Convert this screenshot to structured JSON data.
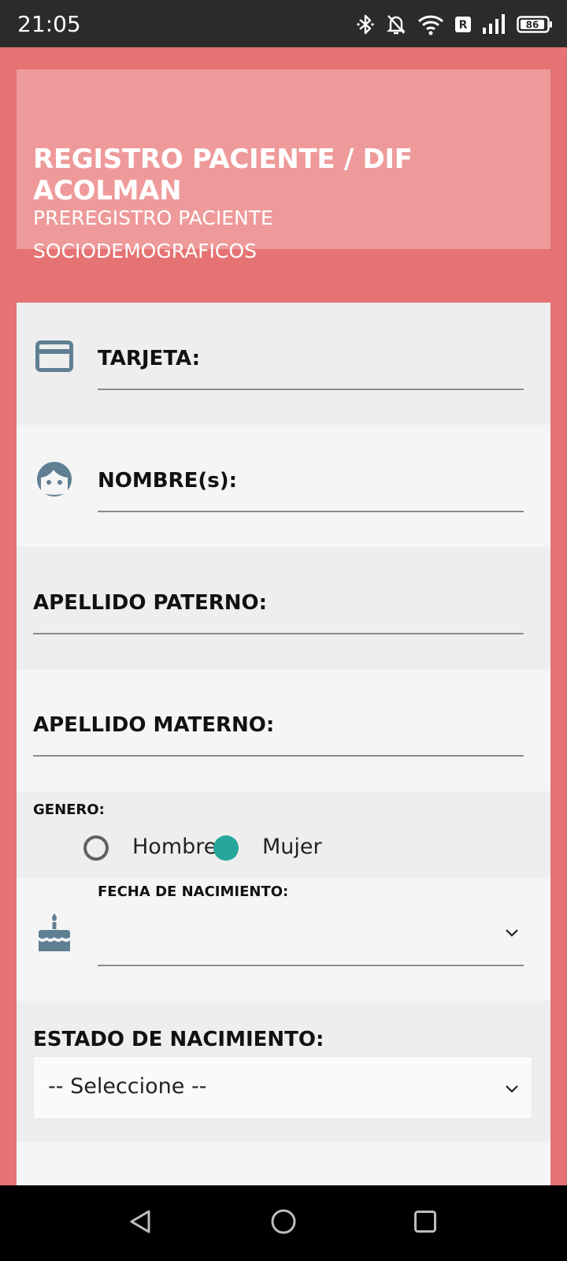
{
  "status_bar": {
    "time": "21:05",
    "battery": "86",
    "icons": [
      "bluetooth-icon",
      "bell-off-icon",
      "wifi-icon",
      "roaming-icon",
      "signal-icon",
      "battery-icon"
    ]
  },
  "header": {
    "title": "REGISTRO PACIENTE / DIF ACOLMAN",
    "subtitle_1": "PREREGISTRO PACIENTE",
    "subtitle_2": "SOCIODEMOGRAFICOS"
  },
  "form": {
    "tarjeta": {
      "label": "TARJETA:",
      "value": "",
      "icon": "credit-card-icon"
    },
    "nombre": {
      "label": "NOMBRE(s):",
      "value": "",
      "icon": "face-icon"
    },
    "apellido_paterno": {
      "label": "APELLIDO PATERNO:",
      "value": ""
    },
    "apellido_materno": {
      "label": "APELLIDO MATERNO:",
      "value": ""
    },
    "genero": {
      "label": "GENERO:",
      "options": [
        "Hombre",
        "Mujer"
      ],
      "selected": "Mujer"
    },
    "fecha_nacimiento": {
      "label": "FECHA DE NACIMIENTO:",
      "value": "",
      "icon": "cake-icon"
    },
    "estado_nacimiento": {
      "label": "ESTADO DE NACIMIENTO:",
      "selected": "-- Seleccione --"
    }
  },
  "colors": {
    "background": "#e57373",
    "header_card": "#ef9a9a",
    "icon": "#5f7f93",
    "radio_selected": "#26a69a"
  },
  "nav_bar": {
    "buttons": [
      "back-icon",
      "home-icon",
      "recents-icon"
    ]
  }
}
